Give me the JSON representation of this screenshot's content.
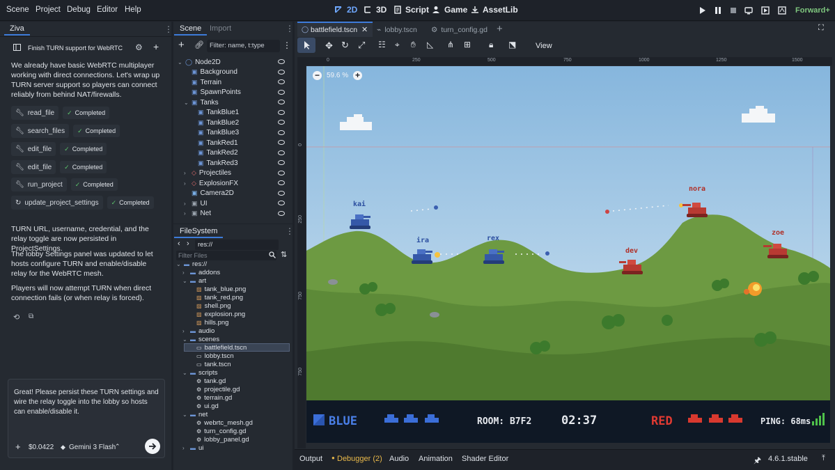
{
  "menu": {
    "items": [
      "Scene",
      "Project",
      "Debug",
      "Editor",
      "Help"
    ]
  },
  "workspaces": {
    "w2d": "2D",
    "w3d": "3D",
    "script": "Script",
    "game": "Game",
    "assetlib": "AssetLib"
  },
  "renderer": "Forward+",
  "assistant": {
    "tab": "Ziva",
    "thread_title": "Finish TURN support for WebRTC",
    "intro": "We already have basic WebRTC multiplayer working with direct connections. Let's wrap up TURN server support so players can connect reliably from behind NAT/firewalls.",
    "tools": [
      {
        "name": "read_file",
        "status": "Completed"
      },
      {
        "name": "search_files",
        "status": "Completed"
      },
      {
        "name": "edit_file",
        "status": "Completed"
      },
      {
        "name": "edit_file",
        "status": "Completed"
      },
      {
        "name": "run_project",
        "status": "Completed"
      },
      {
        "name": "update_project_settings",
        "status": "Completed"
      }
    ],
    "summary": [
      "TURN URL, username, credential, and the relay toggle are now persisted in ProjectSettings.",
      "The lobby Settings panel was updated to let hosts configure TURN and enable/disable relay for the WebRTC mesh.",
      "Players will now attempt TURN when direct connection fails (or when relay is forced)."
    ],
    "input_text": "Great! Please persist these TURN settings and wire the relay toggle into the lobby so hosts can enable/disable it.",
    "cost": "$0.0422",
    "model": "Gemini 3 Flash"
  },
  "scene_dock": {
    "tabs": [
      "Scene",
      "Import"
    ],
    "filter_placeholder": "Filter: name, t:type",
    "nodes": [
      {
        "name": "Node2D",
        "depth": 0,
        "arrow": "v",
        "color": "#6d95d6"
      },
      {
        "name": "Background",
        "depth": 1,
        "arrow": "",
        "color": "#6d95d6"
      },
      {
        "name": "Terrain",
        "depth": 1,
        "arrow": "",
        "color": "#6d95d6"
      },
      {
        "name": "SpawnPoints",
        "depth": 1,
        "arrow": "",
        "color": "#6d95d6"
      },
      {
        "name": "Tanks",
        "depth": 1,
        "arrow": "v",
        "color": "#6d95d6"
      },
      {
        "name": "TankBlue1",
        "depth": 2,
        "arrow": "",
        "color": "#6d95d6"
      },
      {
        "name": "TankBlue2",
        "depth": 2,
        "arrow": "",
        "color": "#6d95d6"
      },
      {
        "name": "TankBlue3",
        "depth": 2,
        "arrow": "",
        "color": "#6d95d6"
      },
      {
        "name": "TankRed1",
        "depth": 2,
        "arrow": "",
        "color": "#6d95d6"
      },
      {
        "name": "TankRed2",
        "depth": 2,
        "arrow": "",
        "color": "#6d95d6"
      },
      {
        "name": "TankRed3",
        "depth": 2,
        "arrow": "",
        "color": "#6d95d6"
      },
      {
        "name": "Projectiles",
        "depth": 1,
        "arrow": ">",
        "color": "#e06c6c"
      },
      {
        "name": "ExplosionFX",
        "depth": 1,
        "arrow": ">",
        "color": "#e06c6c"
      },
      {
        "name": "Camera2D",
        "depth": 1,
        "arrow": "",
        "color": "#7ab0e8"
      },
      {
        "name": "UI",
        "depth": 1,
        "arrow": ">",
        "color": "#9aa3ad"
      },
      {
        "name": "Net",
        "depth": 1,
        "arrow": ">",
        "color": "#9aa3ad"
      }
    ]
  },
  "filesystem": {
    "tab": "FileSystem",
    "path": "res://",
    "filter_placeholder": "Filter Files",
    "items": [
      {
        "name": "res://",
        "depth": 0,
        "kind": "folder",
        "arrow": "v"
      },
      {
        "name": "addons",
        "depth": 1,
        "kind": "folder",
        "arrow": ">"
      },
      {
        "name": "art",
        "depth": 1,
        "kind": "folder",
        "arrow": "v"
      },
      {
        "name": "tank_blue.png",
        "depth": 2,
        "kind": "image",
        "arrow": ""
      },
      {
        "name": "tank_red.png",
        "depth": 2,
        "kind": "image",
        "arrow": ""
      },
      {
        "name": "shell.png",
        "depth": 2,
        "kind": "image",
        "arrow": ""
      },
      {
        "name": "explosion.png",
        "depth": 2,
        "kind": "image",
        "arrow": ""
      },
      {
        "name": "hills.png",
        "depth": 2,
        "kind": "image",
        "arrow": ""
      },
      {
        "name": "audio",
        "depth": 1,
        "kind": "folder",
        "arrow": ">"
      },
      {
        "name": "scenes",
        "depth": 1,
        "kind": "folder",
        "arrow": "v"
      },
      {
        "name": "battlefield.tscn",
        "depth": 2,
        "kind": "scene",
        "arrow": "",
        "selected": true
      },
      {
        "name": "lobby.tscn",
        "depth": 2,
        "kind": "scene",
        "arrow": ""
      },
      {
        "name": "tank.tscn",
        "depth": 2,
        "kind": "scene",
        "arrow": ""
      },
      {
        "name": "scripts",
        "depth": 1,
        "kind": "folder",
        "arrow": "v"
      },
      {
        "name": "tank.gd",
        "depth": 2,
        "kind": "script",
        "arrow": ""
      },
      {
        "name": "projectile.gd",
        "depth": 2,
        "kind": "script",
        "arrow": ""
      },
      {
        "name": "terrain.gd",
        "depth": 2,
        "kind": "script",
        "arrow": ""
      },
      {
        "name": "ui.gd",
        "depth": 2,
        "kind": "script",
        "arrow": ""
      },
      {
        "name": "net",
        "depth": 1,
        "kind": "folder",
        "arrow": "v"
      },
      {
        "name": "webrtc_mesh.gd",
        "depth": 2,
        "kind": "script",
        "arrow": ""
      },
      {
        "name": "turn_config.gd",
        "depth": 2,
        "kind": "script",
        "arrow": ""
      },
      {
        "name": "lobby_panel.gd",
        "depth": 2,
        "kind": "script",
        "arrow": ""
      },
      {
        "name": "ui",
        "depth": 1,
        "kind": "folder",
        "arrow": ">"
      }
    ]
  },
  "editor_tabs": [
    "battlefield.tscn",
    "lobby.tscn",
    "turn_config.gd"
  ],
  "toolbar": {
    "view": "View"
  },
  "ruler": {
    "h": [
      "0",
      "250",
      "500",
      "750",
      "1000",
      "1250",
      "1500"
    ],
    "v": [
      "0",
      "250",
      "750",
      "750"
    ]
  },
  "zoom": "59.6 %",
  "game": {
    "blue_team": "BLUE",
    "red_team": "RED",
    "room": "ROOM: B7F2",
    "timer": "02:37",
    "ping": "PING: 68ms",
    "players": [
      "kai",
      "ira",
      "rex",
      "dev",
      "nora",
      "zoe"
    ]
  },
  "bottom_tabs": [
    "Output",
    "Debugger (2)",
    "Audio",
    "Animation",
    "Shader Editor"
  ],
  "version": "4.6.1.stable"
}
